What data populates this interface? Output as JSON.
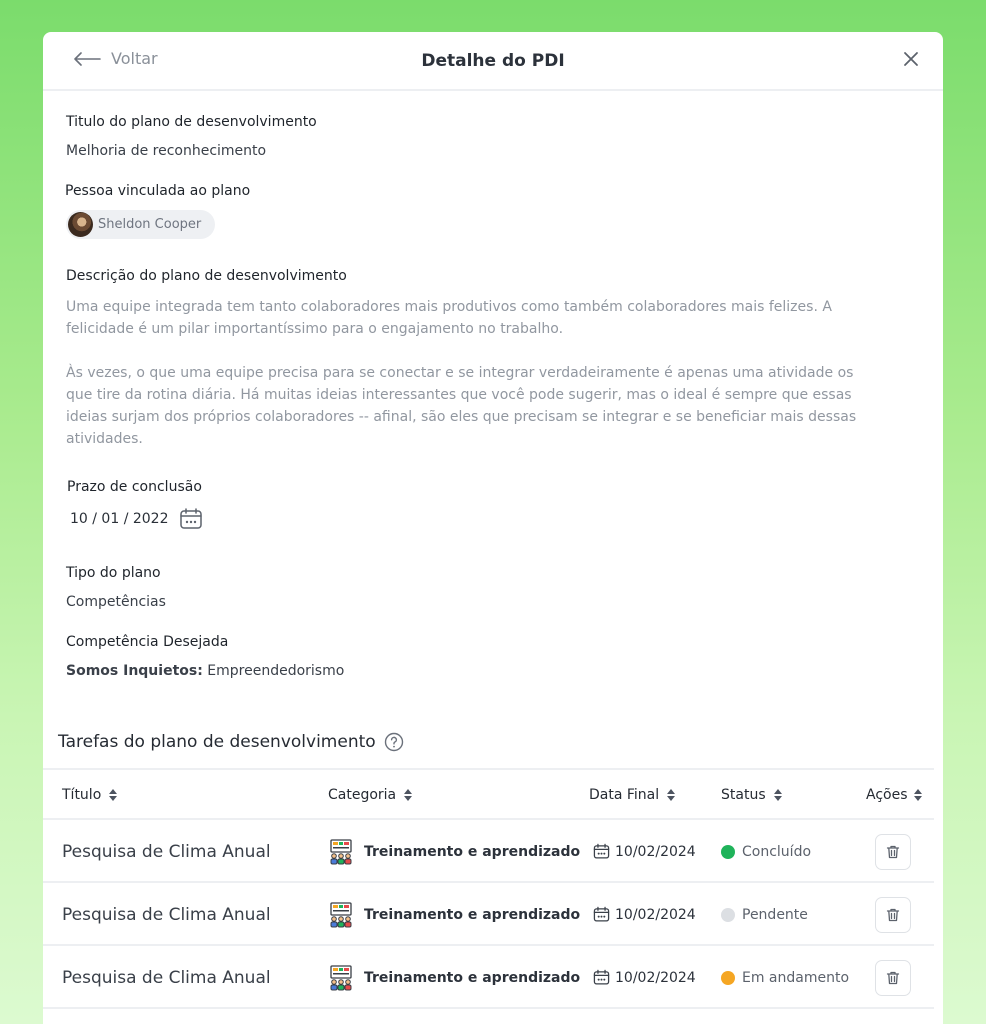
{
  "header": {
    "back_label": "Voltar",
    "title": "Detalhe do PDI"
  },
  "plan": {
    "title_label": "Titulo do plano de desenvolvimento",
    "title_value": "Melhoria de reconhecimento",
    "person_label": "Pessoa vinculada ao plano",
    "person_name": "Sheldon Cooper",
    "description_label": "Descrição do plano de desenvolvimento",
    "description_p1_l1": "Uma equipe integrada tem tanto colaboradores mais produtivos como também colaboradores mais felizes. A",
    "description_p1_l2": "felicidade é um pilar importantíssimo para o engajamento no trabalho.",
    "description_p2_l1": "Às vezes, o que uma equipe precisa para se conectar e se integrar verdadeiramente é apenas uma atividade os",
    "description_p2_l2": "que tire da rotina diária. Há muitas ideias interessantes que você pode sugerir, mas o ideal é sempre que essas",
    "description_p2_l3": "ideias surjam dos próprios colaboradores -- afinal, são eles que precisam se integrar e se beneficiar mais dessas",
    "description_p2_l4": "atividades.",
    "deadline_label": "Prazo de conclusão",
    "deadline_value": "10 / 01 / 2022",
    "type_label": "Tipo do plano",
    "type_value": "Competências",
    "competency_label": "Competência Desejada",
    "competency_group": "Somos Inquietos:",
    "competency_value": "Empreendedorismo"
  },
  "tasks": {
    "section_title": "Tarefas do plano de desenvolvimento",
    "columns": {
      "title": "Título",
      "category": "Categoria",
      "due_date": "Data Final",
      "status": "Status",
      "actions": "Ações"
    },
    "rows": [
      {
        "title": "Pesquisa de Clima Anual",
        "category": "Treinamento e aprendizado",
        "due_date": "10/02/2024",
        "status": "Concluído",
        "status_color": "#1fb35a"
      },
      {
        "title": "Pesquisa de Clima Anual",
        "category": "Treinamento e aprendizado",
        "due_date": "10/02/2024",
        "status": "Pendente",
        "status_color": "#dcdfe3"
      },
      {
        "title": "Pesquisa de Clima Anual",
        "category": "Treinamento e aprendizado",
        "due_date": "10/02/2024",
        "status": "Em andamento",
        "status_color": "#f5a623"
      }
    ]
  }
}
